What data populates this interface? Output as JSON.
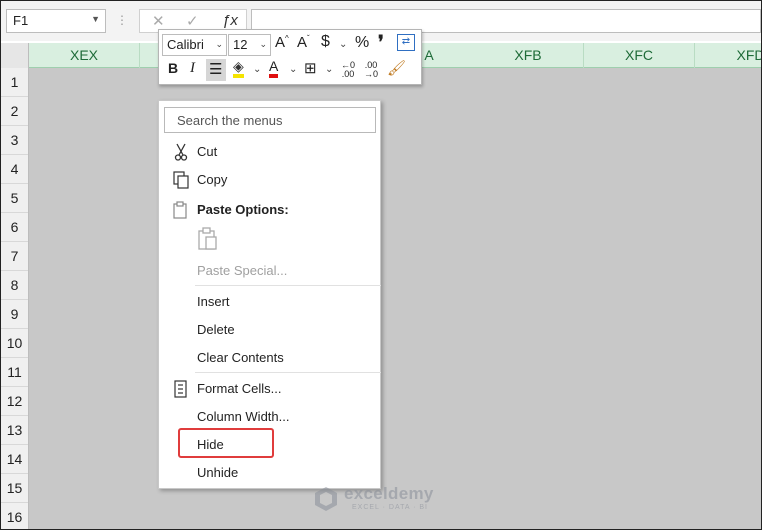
{
  "formula_bar": {
    "name_box": "F1",
    "formula": ""
  },
  "grid": {
    "columns": [
      "XEX",
      "XFB",
      "XFC",
      "XFD"
    ],
    "rows": [
      "1",
      "2",
      "3",
      "4",
      "5",
      "6",
      "7",
      "8",
      "9",
      "10",
      "11",
      "12",
      "13",
      "14",
      "15",
      "16"
    ]
  },
  "mini_toolbar": {
    "font_name": "Calibri",
    "font_size": "12",
    "visible_column_fragment": "A"
  },
  "context_menu": {
    "search_placeholder": "Search the menus",
    "cut": "Cut",
    "copy": "Copy",
    "paste_options": "Paste Options:",
    "paste_special": "Paste Special...",
    "insert": "Insert",
    "delete": "Delete",
    "clear_contents": "Clear Contents",
    "format_cells": "Format Cells...",
    "column_width": "Column Width...",
    "hide": "Hide",
    "unhide": "Unhide"
  },
  "watermark": {
    "name": "exceldemy",
    "tagline": "EXCEL · DATA · BI"
  },
  "colors": {
    "header_bg": "#d9efe0",
    "header_text": "#1e6b38",
    "selected_cells": "#c8c8c8",
    "highlight": "#e03c3c"
  }
}
